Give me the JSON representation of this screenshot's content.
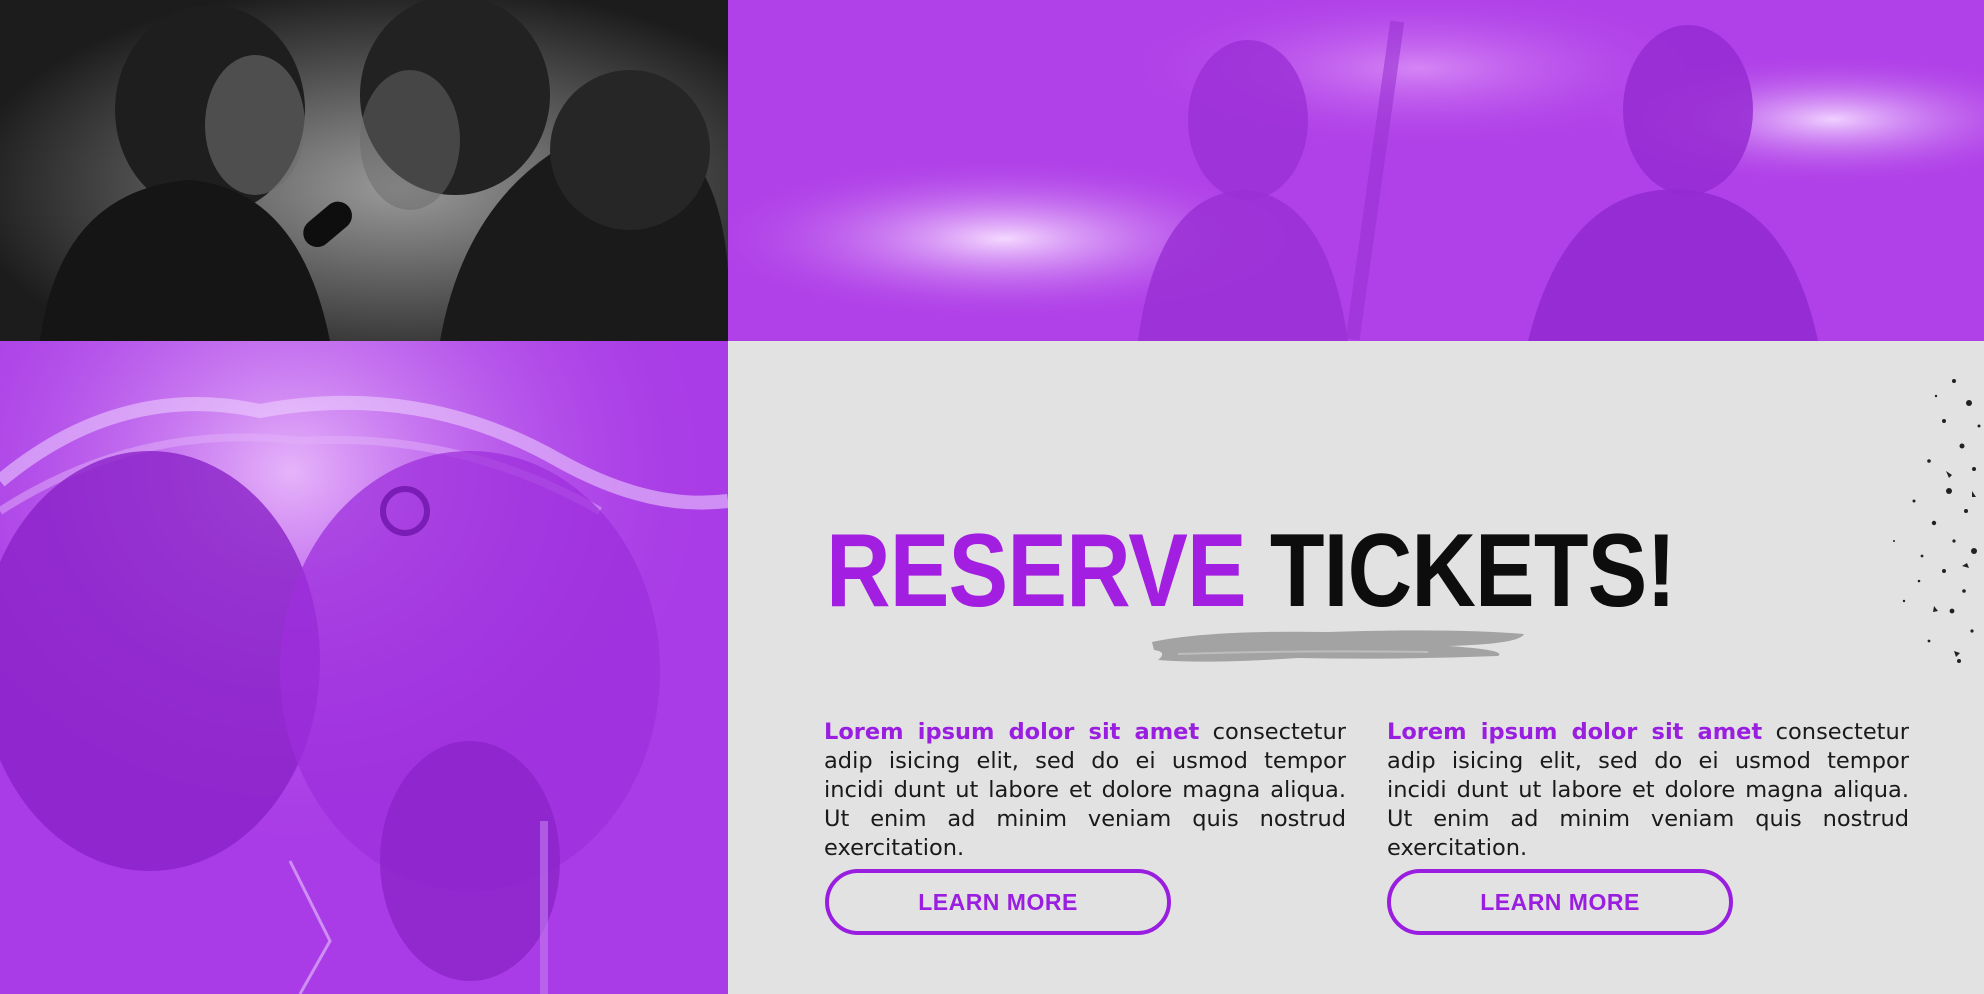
{
  "heading": {
    "word_1": "RESERVE",
    "word_2": "TICKETS!"
  },
  "columns": [
    {
      "lead": "Lorem ipsum dolor sit amet",
      "body": " consectetur adip isicing elit, sed do ei usmod tempor incidi dunt ut labore et dolore magna aliqua. Ut enim ad minim veniam quis nostrud exercitation.",
      "button_label": "LEARN MORE"
    },
    {
      "lead": "Lorem ipsum dolor sit amet",
      "body": " consectetur adip isicing elit, sed do ei usmod tempor incidi dunt ut labore et dolore magna aliqua. Ut enim ad minim veniam quis nostrud exercitation.",
      "button_label": "LEARN MORE"
    }
  ],
  "colors": {
    "accent": "#a21ee0",
    "photo_tint": "#b040e8",
    "background": "#e2e2e2",
    "text_dark": "#0d0d0d",
    "brush_gray": "#a3a3a3"
  }
}
